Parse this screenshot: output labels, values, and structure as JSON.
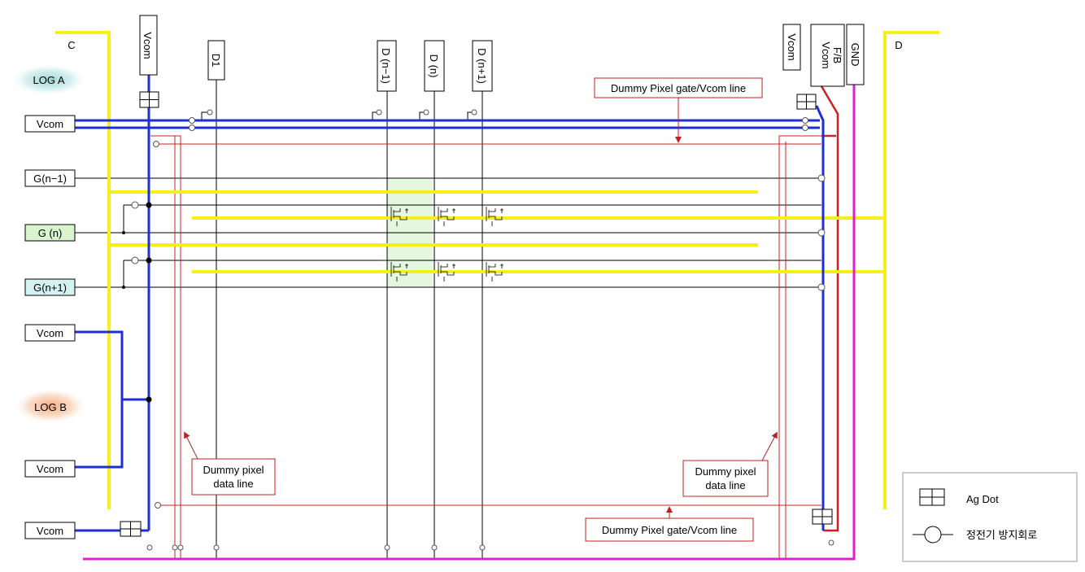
{
  "corner_labels": {
    "c": "C",
    "d": "D"
  },
  "log_labels": {
    "a": "LOG A",
    "b": "LOG B"
  },
  "left_labels": {
    "vcom_top": "Vcom",
    "g_prev": "G(n−1)",
    "g_n": "G (n)",
    "g_next": "G(n+1)",
    "vcom_mid1": "Vcom",
    "vcom_mid2": "Vcom",
    "vcom_bottom": "Vcom"
  },
  "top_labels": {
    "vcom_left": "Vcom",
    "d1": "D1",
    "d_prev": "D (n−1)",
    "d_n": "D (n)",
    "d_next": "D (n+1)",
    "vcom_right": "Vcom",
    "vcom_fb_1": "Vcom",
    "vcom_fb_2": "F/B",
    "gnd": "GND"
  },
  "callouts": {
    "dummy_gate_top": "Dummy Pixel gate/Vcom line",
    "dummy_gate_bottom": "Dummy Pixel gate/Vcom line",
    "dummy_data_left_1": "Dummy pixel",
    "dummy_data_left_2": "data line",
    "dummy_data_right_1": "Dummy pixel",
    "dummy_data_right_2": "data line"
  },
  "legend": {
    "ag_dot": "Ag Dot",
    "esd_circuit": "정전기 방지회로"
  },
  "colors": {
    "vcom_line": "#1f2fd6",
    "yellow_line": "#f7ef1a",
    "gnd_line": "#e020d0",
    "dummy_line": "#d02020",
    "signal_line": "#000000",
    "log_a_glow": "#8fd0d0",
    "log_b_glow": "#f4a070",
    "g_n_fill": "#d8f5d0",
    "g_next_fill": "#d4f2f2",
    "callout_border": "#c02020"
  }
}
